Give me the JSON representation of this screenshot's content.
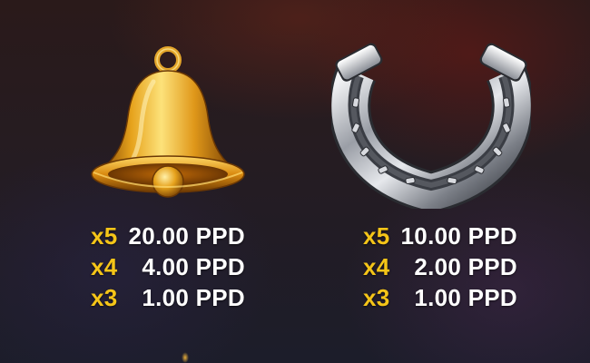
{
  "symbols": [
    {
      "icon": "bell-icon",
      "payouts": [
        {
          "multiplier": "x5",
          "amount": "20.00 PPD"
        },
        {
          "multiplier": "x4",
          "amount": "4.00 PPD"
        },
        {
          "multiplier": "x3",
          "amount": "1.00 PPD"
        }
      ]
    },
    {
      "icon": "horseshoe-icon",
      "payouts": [
        {
          "multiplier": "x5",
          "amount": "10.00 PPD"
        },
        {
          "multiplier": "x4",
          "amount": "2.00 PPD"
        },
        {
          "multiplier": "x3",
          "amount": "1.00 PPD"
        }
      ]
    }
  ],
  "colors": {
    "multiplier": "#f5c518",
    "amount": "#ffffff",
    "bell_gold": "#e0a21a",
    "horseshoe_silver": "#b9bcc2"
  }
}
